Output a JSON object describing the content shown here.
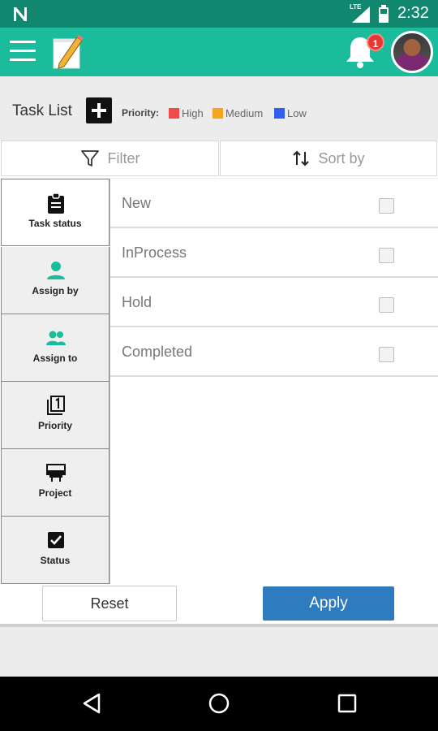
{
  "status_bar": {
    "network": "LTE",
    "time": "2:32"
  },
  "app_bar": {
    "notification_count": "1"
  },
  "task_list": {
    "title": "Task List",
    "priority_label": "Priority:",
    "legend": [
      {
        "label": "High",
        "color": "#f04b4b"
      },
      {
        "label": "Medium",
        "color": "#f6a31d"
      },
      {
        "label": "Low",
        "color": "#2f5ff0"
      }
    ]
  },
  "toolbar": {
    "filter_label": "Filter",
    "sort_label": "Sort by"
  },
  "filter_tabs": [
    {
      "label": "Task status",
      "icon": "clipboard-icon",
      "active": true
    },
    {
      "label": "Assign by",
      "icon": "person-icon",
      "active": false
    },
    {
      "label": "Assign to",
      "icon": "people-icon",
      "active": false
    },
    {
      "label": "Priority",
      "icon": "filter-1-icon",
      "active": false
    },
    {
      "label": "Project",
      "icon": "project-icon",
      "active": false
    },
    {
      "label": "Status",
      "icon": "checkbox-icon",
      "active": false
    }
  ],
  "options": [
    {
      "label": "New",
      "checked": false
    },
    {
      "label": "InProcess",
      "checked": false
    },
    {
      "label": "Hold",
      "checked": false
    },
    {
      "label": "Completed",
      "checked": false
    }
  ],
  "actions": {
    "reset_label": "Reset",
    "apply_label": "Apply"
  },
  "colors": {
    "status_bar": "#12876f",
    "app_bar": "#1abc9c",
    "accent": "#1abc9c",
    "apply": "#2e7bbf"
  }
}
